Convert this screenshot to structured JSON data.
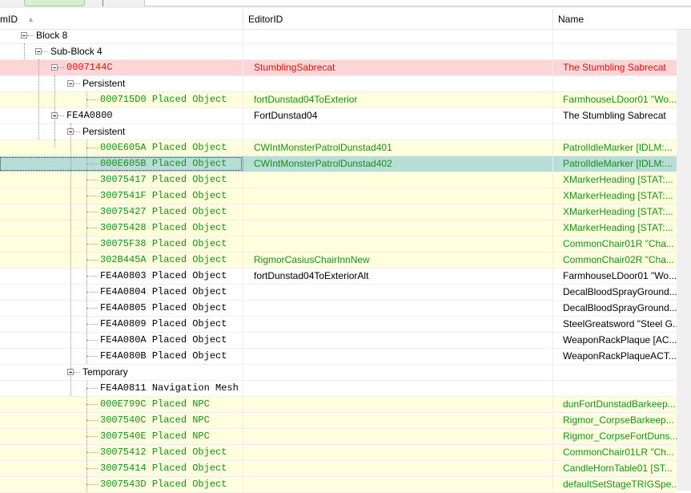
{
  "header": {
    "col_formid": "mID",
    "col_editorid": "EditorID",
    "col_name": "Name"
  },
  "rows": [
    {
      "level": 1,
      "label": "Block 8",
      "type": "",
      "editor": "",
      "name": "",
      "style": "",
      "mono": false,
      "exp": true
    },
    {
      "level": 2,
      "label": "Sub-Block 4",
      "type": "",
      "editor": "",
      "name": "",
      "style": "",
      "mono": false,
      "exp": true
    },
    {
      "level": 3,
      "label": "0007144C",
      "type": "",
      "editor": "StumblingSabrecat",
      "name": "The Stumbling Sabrecat",
      "style": "red",
      "mono": true,
      "exp": true
    },
    {
      "level": 4,
      "label": "Persistent",
      "type": "",
      "editor": "",
      "name": "",
      "style": "",
      "mono": false,
      "exp": true
    },
    {
      "level": 5,
      "label": "000715D0",
      "type": "Placed Object",
      "editor": "fortDunstad04ToExterior",
      "name": "FarmhouseLDoor01 \"Wo...",
      "style": "green",
      "mono": true,
      "exp": false
    },
    {
      "level": 3,
      "label": "FE4A0800",
      "type": "",
      "editor": "FortDunstad04",
      "name": "The Stumbling Sabrecat",
      "style": "",
      "mono": true,
      "exp": true
    },
    {
      "level": 4,
      "label": "Persistent",
      "type": "",
      "editor": "",
      "name": "",
      "style": "",
      "mono": false,
      "exp": true
    },
    {
      "level": 5,
      "label": "000E605A",
      "type": "Placed Object",
      "editor": "CWIntMonsterPatrolDunstad401",
      "name": "PatrolIdleMarker [IDLM:...",
      "style": "green",
      "mono": true,
      "exp": false
    },
    {
      "level": 5,
      "label": "000E605B",
      "type": "Placed Object",
      "editor": "CWIntMonsterPatrolDunstad402",
      "name": "PatrolIdleMarker [IDLM:...",
      "style": "green-sel",
      "mono": true,
      "exp": false
    },
    {
      "level": 5,
      "label": "30075417",
      "type": "Placed Object",
      "editor": "",
      "name": "XMarkerHeading [STAT:...",
      "style": "green",
      "mono": true,
      "exp": false
    },
    {
      "level": 5,
      "label": "3007541F",
      "type": "Placed Object",
      "editor": "",
      "name": "XMarkerHeading [STAT:...",
      "style": "green",
      "mono": true,
      "exp": false
    },
    {
      "level": 5,
      "label": "30075427",
      "type": "Placed Object",
      "editor": "",
      "name": "XMarkerHeading [STAT:...",
      "style": "green",
      "mono": true,
      "exp": false
    },
    {
      "level": 5,
      "label": "30075428",
      "type": "Placed Object",
      "editor": "",
      "name": "XMarkerHeading [STAT:...",
      "style": "green",
      "mono": true,
      "exp": false
    },
    {
      "level": 5,
      "label": "30075F38",
      "type": "Placed Object",
      "editor": "",
      "name": "CommonChair01R \"Cha...",
      "style": "green",
      "mono": true,
      "exp": false
    },
    {
      "level": 5,
      "label": "302B445A",
      "type": "Placed Object",
      "editor": "RigmorCasiusChairInnNew",
      "name": "CommonChair02R \"Cha...",
      "style": "green",
      "mono": true,
      "exp": false
    },
    {
      "level": 5,
      "label": "FE4A0803",
      "type": "Placed Object",
      "editor": "fortDunstad04ToExteriorAlt",
      "name": "FarmhouseLDoor01 \"Wo...",
      "style": "",
      "mono": true,
      "exp": false
    },
    {
      "level": 5,
      "label": "FE4A0804",
      "type": "Placed Object",
      "editor": "",
      "name": "DecalBloodSprayGround...",
      "style": "",
      "mono": true,
      "exp": false
    },
    {
      "level": 5,
      "label": "FE4A0805",
      "type": "Placed Object",
      "editor": "",
      "name": "DecalBloodSprayGround...",
      "style": "",
      "mono": true,
      "exp": false
    },
    {
      "level": 5,
      "label": "FE4A0809",
      "type": "Placed Object",
      "editor": "",
      "name": "SteelGreatsword \"Steel G...",
      "style": "",
      "mono": true,
      "exp": false
    },
    {
      "level": 5,
      "label": "FE4A080A",
      "type": "Placed Object",
      "editor": "",
      "name": "WeaponRackPlaque [AC...",
      "style": "",
      "mono": true,
      "exp": false
    },
    {
      "level": 5,
      "label": "FE4A080B",
      "type": "Placed Object",
      "editor": "",
      "name": "WeaponRackPlaqueACT...",
      "style": "",
      "mono": true,
      "exp": false
    },
    {
      "level": 4,
      "label": "Temporary",
      "type": "",
      "editor": "",
      "name": "",
      "style": "",
      "mono": false,
      "exp": true
    },
    {
      "level": 5,
      "label": "FE4A0811",
      "type": "Navigation Mesh",
      "editor": "",
      "name": "",
      "style": "",
      "mono": true,
      "exp": false
    },
    {
      "level": 5,
      "label": "000E799C",
      "type": "Placed NPC",
      "editor": "",
      "name": "dunFortDunstadBarkeep...",
      "style": "green",
      "mono": true,
      "exp": false
    },
    {
      "level": 5,
      "label": "3007540C",
      "type": "Placed NPC",
      "editor": "",
      "name": "Rigmor_CorpseBarkeep...",
      "style": "green",
      "mono": true,
      "exp": false
    },
    {
      "level": 5,
      "label": "3007540E",
      "type": "Placed NPC",
      "editor": "",
      "name": "Rigmor_CorpseFortDuns...",
      "style": "green",
      "mono": true,
      "exp": false
    },
    {
      "level": 5,
      "label": "30075412",
      "type": "Placed Object",
      "editor": "",
      "name": "CommonChair01LR \"Ch...",
      "style": "green",
      "mono": true,
      "exp": false
    },
    {
      "level": 5,
      "label": "30075414",
      "type": "Placed Object",
      "editor": "",
      "name": "CandleHornTable01 [ST...",
      "style": "green",
      "mono": true,
      "exp": false
    },
    {
      "level": 5,
      "label": "3007543D",
      "type": "Placed Object",
      "editor": "",
      "name": "defaultSetStageTRIGSpe...",
      "style": "green",
      "mono": true,
      "exp": false
    }
  ]
}
